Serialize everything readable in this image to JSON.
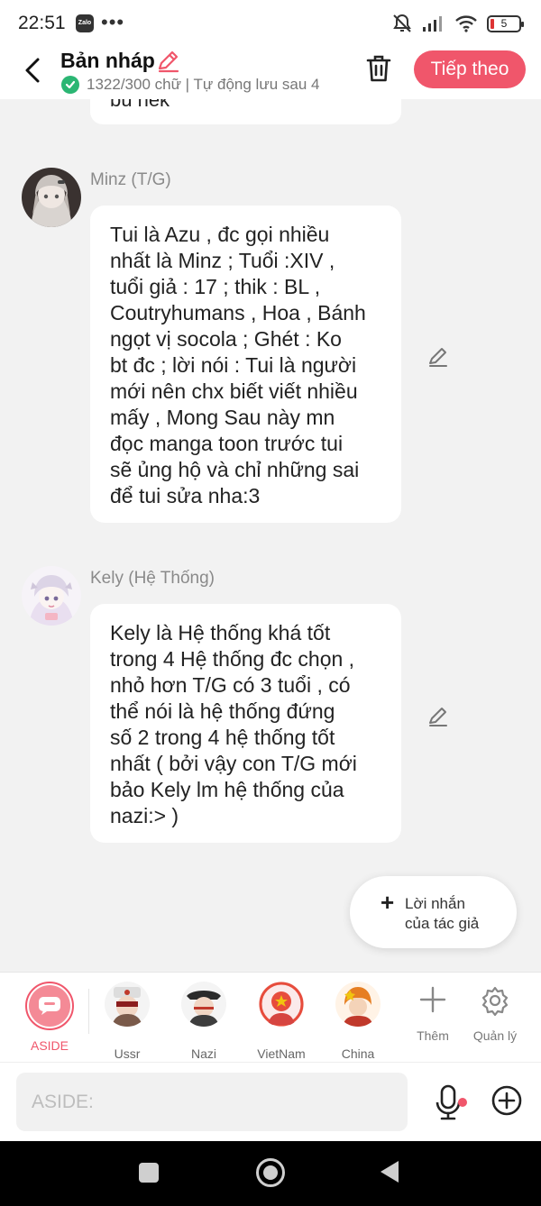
{
  "status_bar": {
    "time": "22:51",
    "app_badge": "Zalo",
    "more": "•••",
    "battery": "5"
  },
  "header": {
    "title": "Bản nháp",
    "subtitle": "1322/300 chữ | Tự động lưu sau 4",
    "next_label": "Tiếp theo"
  },
  "previous_message_tail": "bú hek",
  "messages": [
    {
      "name": "Minz (T/G)",
      "text": "Tui là Azu , đc gọi nhiều\nnhất là Minz ; Tuổi :XIV ,\ntuổi giả : 17 ; thik : BL ,\nCoutryhumans , Hoa , Bánh\nngọt vị socola ; Ghét : Ko\nbt đc ; lời nói : Tui là người\nmới nên chx biết viết nhiều\nmấy , Mong Sau này mn\nđọc manga toon trước tui\nsẽ ủng hộ và chỉ những sai\nđể tui sửa nha:3"
    },
    {
      "name": "Kely (Hệ Thống)",
      "text": "Kely là Hệ thống khá tốt\ntrong 4 Hệ thống đc chọn ,\nnhỏ hơn T/G có 3 tuổi , có\nthể nói là hệ thống đứng\nsố 2 trong 4 hệ thống tốt\nnhất ( bởi vậy con T/G mới\nbảo Kely lm hệ thống của\nnazi:>  )"
    }
  ],
  "author_note": {
    "plus": "+",
    "label": "Lời nhắn\ncủa tác giả"
  },
  "character_bar": {
    "aside_label": "ASIDE",
    "characters": [
      "Ussr",
      "Nazi",
      "VietNam",
      "China"
    ],
    "add_label": "Thêm",
    "manage_label": "Quản lý"
  },
  "input": {
    "placeholder": "ASIDE:"
  },
  "colors": {
    "accent": "#f0566b",
    "success": "#2bb673",
    "background": "#f2f2f2"
  },
  "icons": [
    "back-icon",
    "pencil-icon",
    "check-icon",
    "trash-icon",
    "chat-bubble-icon",
    "plus-icon",
    "gear-icon",
    "mic-icon",
    "add-circle-icon",
    "wifi-icon",
    "signal-icon",
    "mute-icon"
  ]
}
